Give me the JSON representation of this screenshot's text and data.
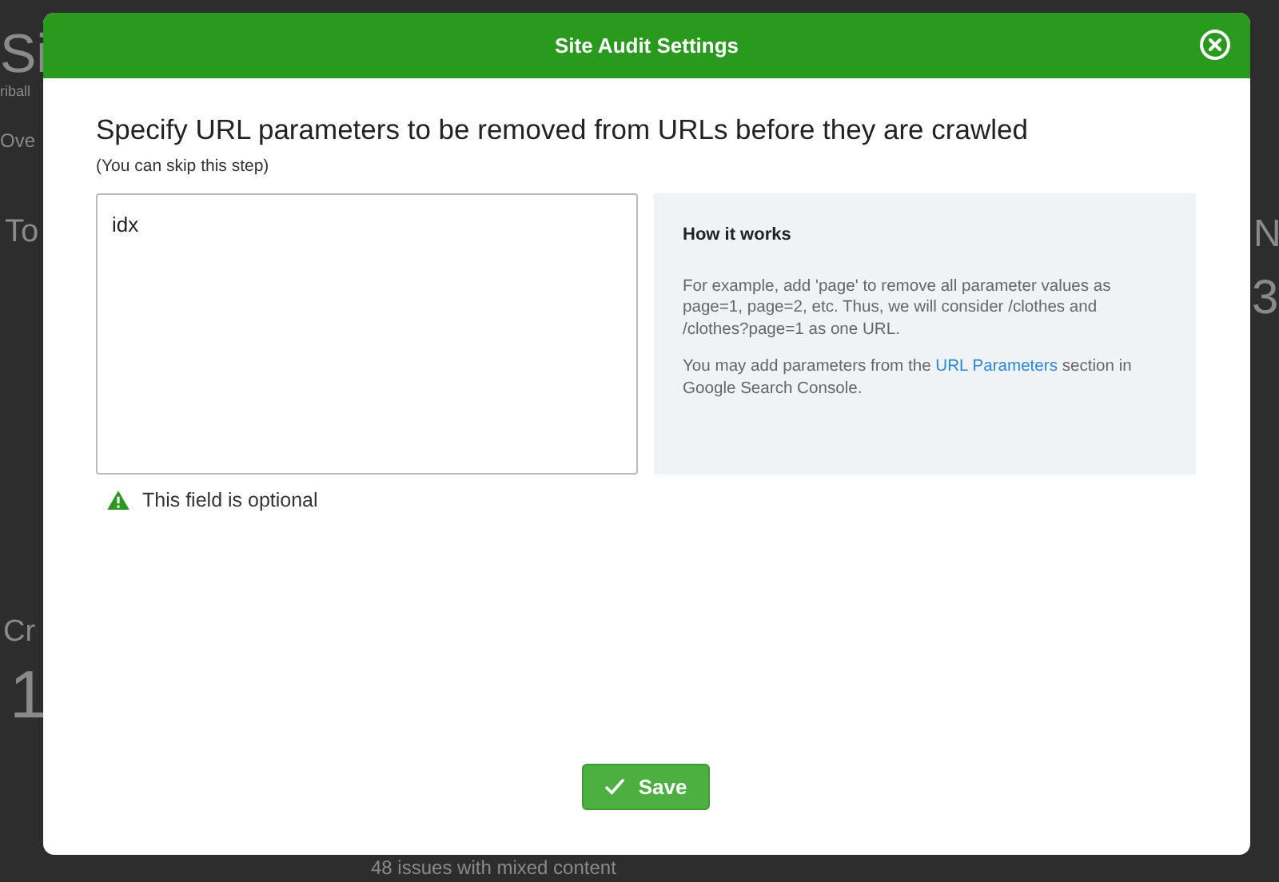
{
  "background": {
    "texts": [
      "Si",
      "riball",
      "Ove",
      "To",
      "Cr",
      "1",
      "N",
      "3",
      "48 issues with mixed content"
    ]
  },
  "dialog": {
    "title": "Site Audit Settings",
    "heading": "Specify URL parameters to be removed from URLs before they are crawled",
    "subheading": "(You can skip this step)",
    "field": {
      "value": "idx",
      "hint": "This field is optional"
    },
    "info": {
      "title": "How it works",
      "paragraphs": [
        "For example, add 'page' to remove all parameter values as page=1, page=2, etc. Thus, we will consider /clothes and /clothes?page=1 as one URL."
      ],
      "link_before": "You may add parameters from the ",
      "link": "URL Parameters",
      "link_after": " section in Google Search Console."
    },
    "save_button": "Save"
  }
}
